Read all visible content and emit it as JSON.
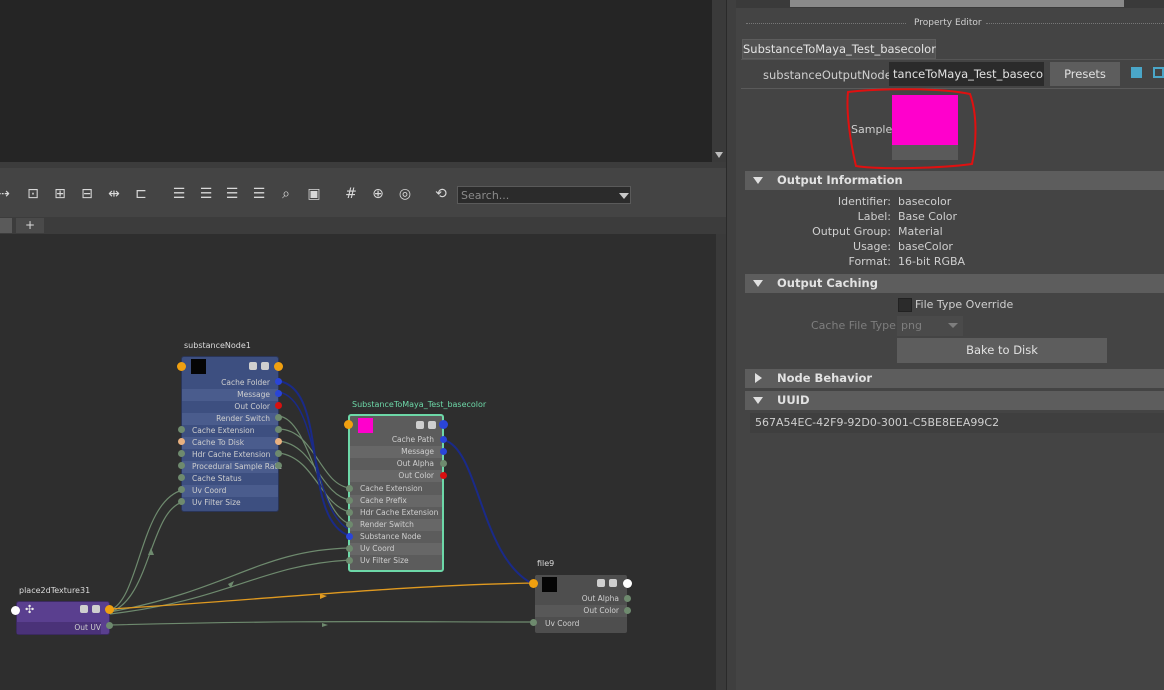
{
  "toolbar": {
    "search_placeholder": "Search..."
  },
  "tabs": {
    "add_label": "+"
  },
  "nodes": {
    "substance": {
      "title": "substanceNode1",
      "outputs": [
        "Cache Folder",
        "Message",
        "Out Color",
        "Render Switch"
      ],
      "inputs": [
        "Cache Extension",
        "Cache To Disk",
        "Hdr Cache Extension",
        "Procedural Sample Rate",
        "Cache Status",
        "Uv Coord",
        "Uv Filter Size"
      ]
    },
    "output": {
      "title": "SubstanceToMaya_Test_basecolor",
      "outputs": [
        "Cache Path",
        "Message",
        "Out Alpha",
        "Out Color"
      ],
      "inputs": [
        "Cache Extension",
        "Cache Prefix",
        "Hdr Cache Extension",
        "Render Switch",
        "Substance Node",
        "Uv Coord",
        "Uv Filter Size"
      ]
    },
    "place2d": {
      "title": "place2dTexture31",
      "out": "Out UV"
    },
    "file": {
      "title": "file9",
      "outputs": [
        "Out Alpha",
        "Out Color"
      ],
      "inputs": [
        "Uv Coord"
      ]
    }
  },
  "colors": {
    "sample": "#ff00cc",
    "annotation": "#e01010",
    "substance_node": "#3d4f80",
    "place2d_node": "#5a3f8f",
    "selected_border": "#6dd8a8"
  },
  "property_editor": {
    "title": "Property Editor",
    "tab_label": "SubstanceToMaya_Test_basecolor",
    "node_label": "substanceOutputNode:",
    "node_value": "tanceToMaya_Test_basecolor",
    "presets_label": "Presets",
    "sample_label": "Sample",
    "sections": {
      "output_information": "Output Information",
      "output_caching": "Output Caching",
      "node_behavior": "Node Behavior",
      "uuid": "UUID"
    },
    "info": [
      {
        "label": "Identifier:",
        "value": "basecolor"
      },
      {
        "label": "Label:",
        "value": "Base Color"
      },
      {
        "label": "Output Group:",
        "value": "Material"
      },
      {
        "label": "Usage:",
        "value": "baseColor"
      },
      {
        "label": "Format:",
        "value": "16-bit RGBA"
      }
    ],
    "file_type_override": "File Type Override",
    "cache_file_type_label": "Cache File Type",
    "cache_file_type_value": "png",
    "bake_label": "Bake to Disk",
    "uuid_value": "567A54EC-42F9-92D0-3001-C5BE8EEA99C2"
  }
}
